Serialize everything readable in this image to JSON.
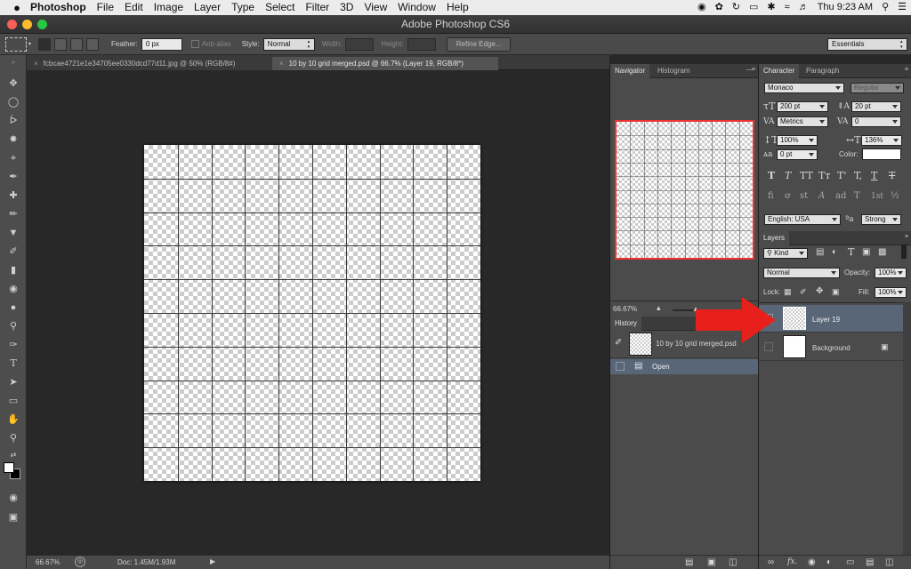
{
  "menubar": {
    "app_name": "Photoshop",
    "items": [
      "File",
      "Edit",
      "Image",
      "Layer",
      "Type",
      "Select",
      "Filter",
      "3D",
      "View",
      "Window",
      "Help"
    ],
    "clock": "Thu 9:23 AM"
  },
  "window": {
    "title": "Adobe Photoshop CS6"
  },
  "options_bar": {
    "feather_label": "Feather:",
    "feather_value": "0 px",
    "antialias_label": "Anti-alias",
    "style_label": "Style:",
    "style_value": "Normal",
    "width_label": "Width:",
    "height_label": "Height:",
    "refine_label": "Refine Edge...",
    "workspace": "Essentials"
  },
  "documents": {
    "tabs": [
      {
        "label": "fcbcae4721e1e34705ee0330dcd77d11.jpg @ 50% (RGB/8#)",
        "active": false
      },
      {
        "label": "10 by 10 grid merged.psd @ 66.7% (Layer 19, RGB/8*)",
        "active": true
      }
    ],
    "grid_divisions": 10
  },
  "status_bar": {
    "zoom": "66.67%",
    "doc_size": "Doc: 1.45M/1.93M"
  },
  "navigator": {
    "tabs": [
      "Navigator",
      "Histogram"
    ],
    "zoom": "66.67%"
  },
  "history": {
    "title": "History",
    "snapshot_name": "10 by 10 grid merged.psd",
    "items": [
      "Open"
    ]
  },
  "character": {
    "tabs": [
      "Character",
      "Paragraph"
    ],
    "font_family": "Monaco",
    "font_style": "Regular",
    "font_size": "200 pt",
    "leading": "20 pt",
    "kerning": "Metrics",
    "tracking": "0",
    "vertical_scale": "100%",
    "horizontal_scale": "136%",
    "baseline_shift": "0 pt",
    "color_label": "Color:",
    "language": "English: USA",
    "antialias": "Strong",
    "style_buttons": [
      "T",
      "T",
      "TT",
      "Tт",
      "T'",
      "T,",
      "T",
      "T"
    ],
    "opentype_buttons": [
      "fi",
      "ơ",
      "st",
      "A",
      "ad",
      "T",
      "1st",
      "½"
    ]
  },
  "layers": {
    "title": "Layers",
    "filter_kind": "Kind",
    "blend_mode": "Normal",
    "opacity_label": "Opacity:",
    "opacity_value": "100%",
    "lock_label": "Lock:",
    "fill_label": "Fill:",
    "fill_value": "100%",
    "items": [
      {
        "name": "Layer 19",
        "selected": true
      },
      {
        "name": "Background",
        "selected": false
      }
    ]
  },
  "colors": {
    "accent_red": "#e8201c",
    "selection_blue": "#596677"
  }
}
